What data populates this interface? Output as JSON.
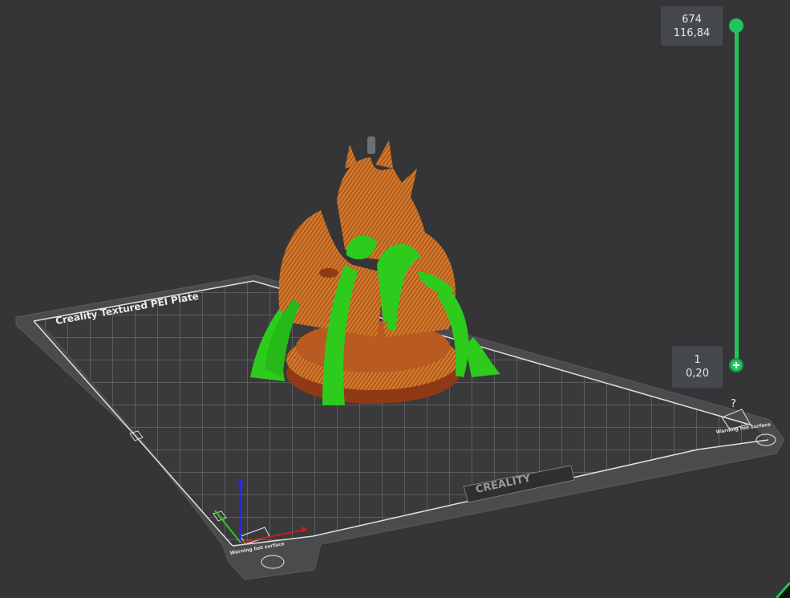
{
  "layer_slider": {
    "top_layer": "674",
    "top_height": "116,84",
    "bottom_layer": "1",
    "bottom_height": "0,20"
  },
  "build_plate": {
    "name": "Creality Textured PEI Plate",
    "brand": "CREALITY",
    "warning_label": "Warning hot surface"
  },
  "help": {
    "label": "?"
  },
  "colors": {
    "background": "#353537",
    "slider": "#22c45e",
    "model": "#d9792a",
    "supports": "#2ccb1c",
    "plate": "#4a4a4c"
  },
  "icons": [
    "help-icon",
    "axes-gizmo-icon",
    "warning-icon",
    "fingerprint-icon",
    "corner-indicator-icon"
  ]
}
